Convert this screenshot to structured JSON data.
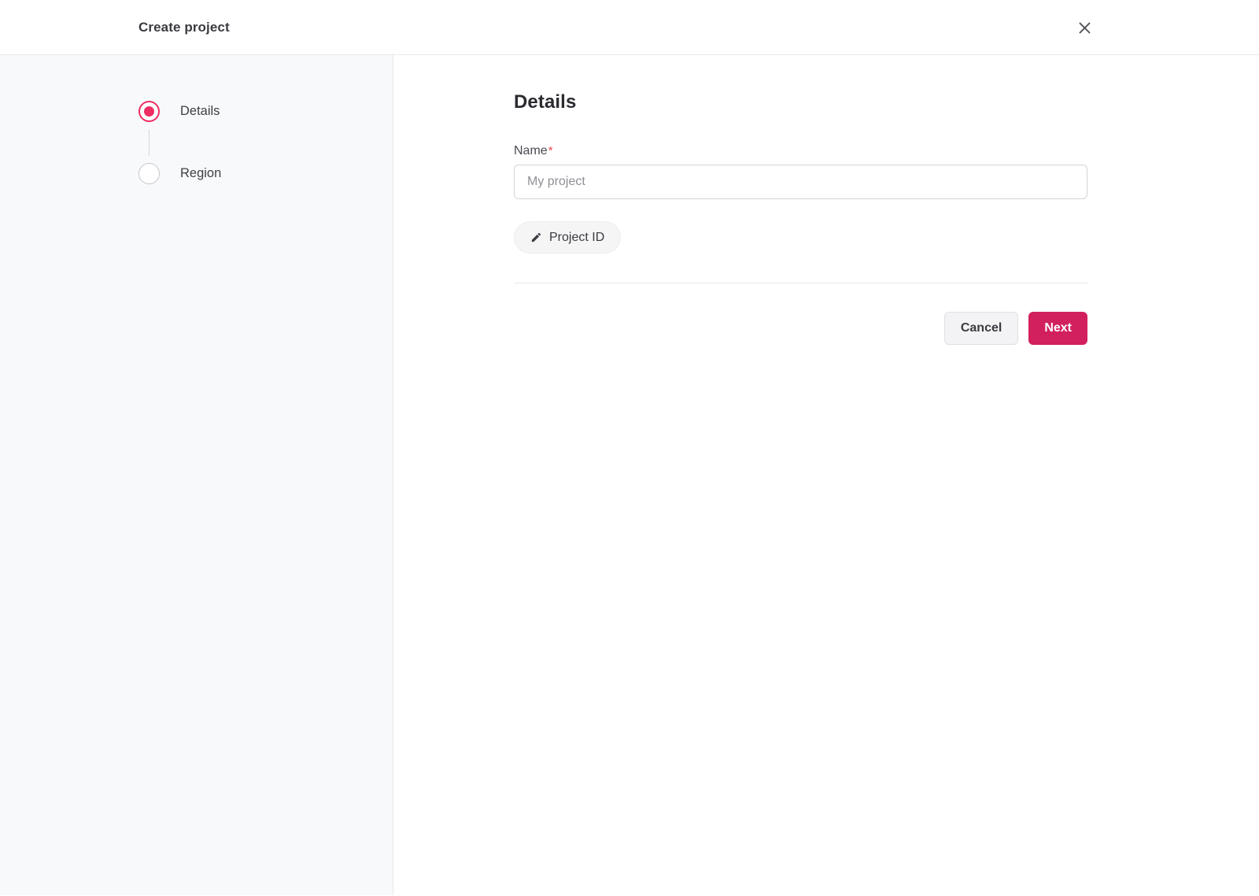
{
  "header": {
    "title": "Create project"
  },
  "stepper": {
    "steps": [
      {
        "label": "Details",
        "state": "active"
      },
      {
        "label": "Region",
        "state": "inactive"
      }
    ]
  },
  "form": {
    "heading": "Details",
    "name_field": {
      "label": "Name",
      "required_marker": "*",
      "value": "",
      "placeholder": "My project"
    },
    "project_id_chip": {
      "label": "Project ID",
      "icon": "pencil-icon"
    }
  },
  "actions": {
    "cancel": "Cancel",
    "next": "Next"
  },
  "icons": {
    "close": "close-icon",
    "pencil": "pencil-icon"
  },
  "colors": {
    "accent_button": "#d2205e",
    "step_active": "#ee2d63",
    "required_marker": "#e5484d",
    "sidebar_bg": "#f8f9fa",
    "border": "#e9e9eb"
  }
}
